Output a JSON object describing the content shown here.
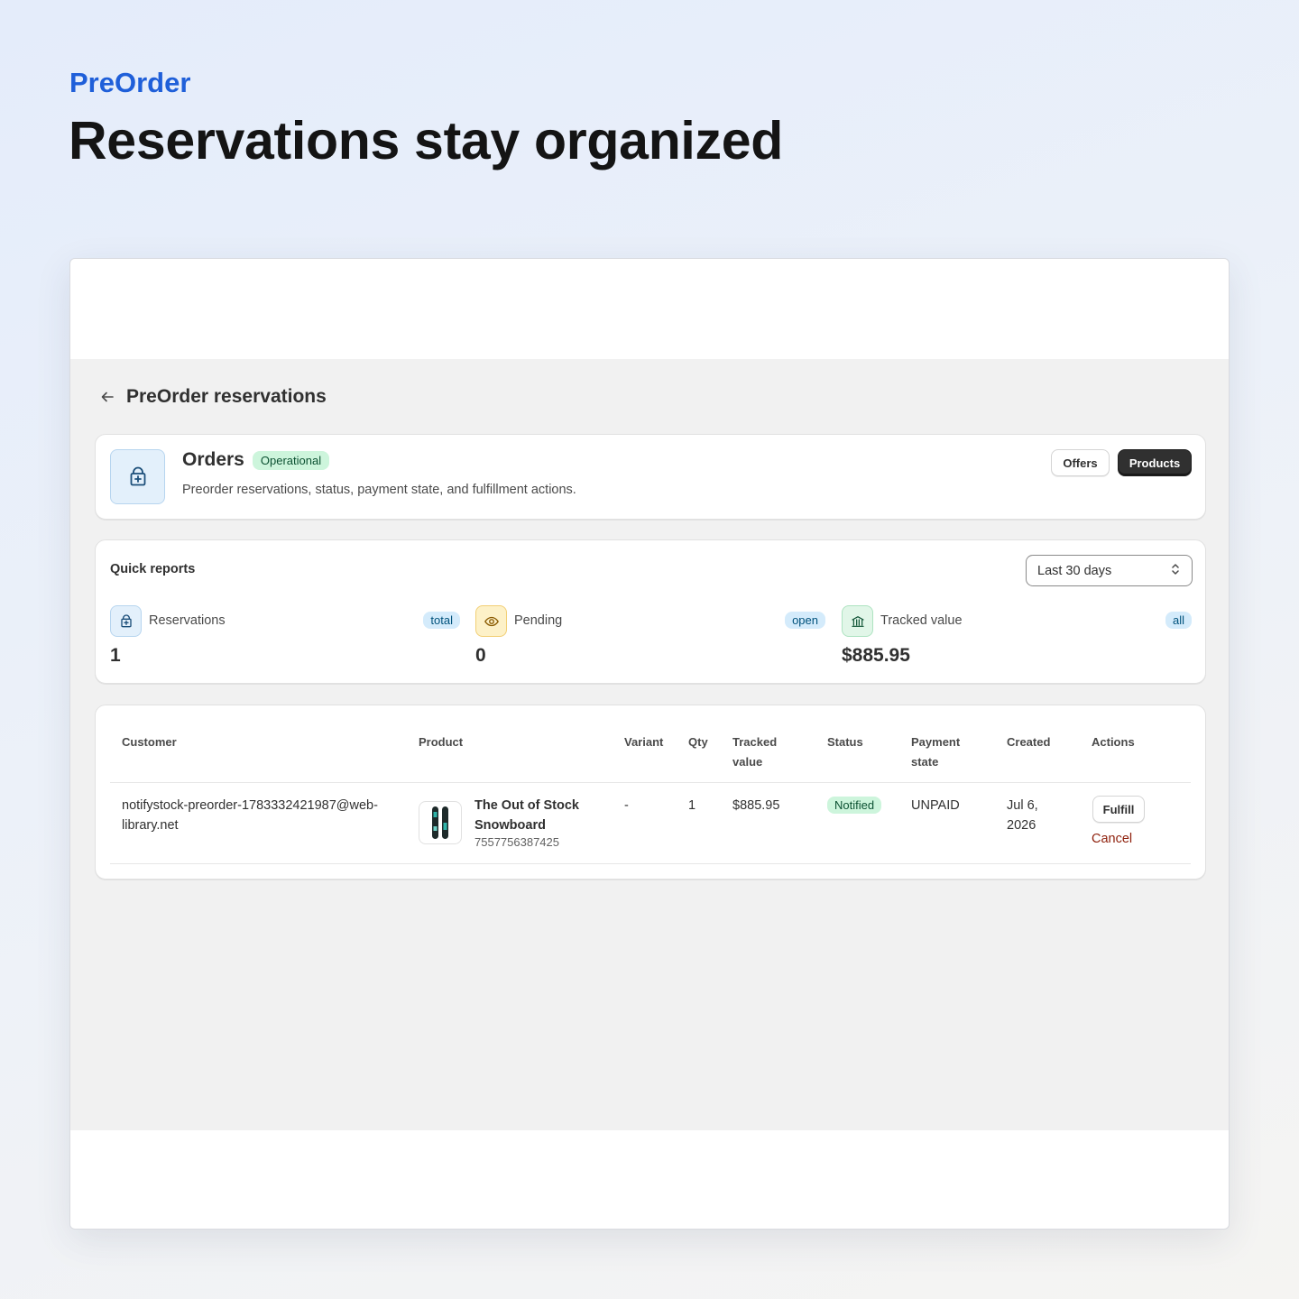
{
  "hero": {
    "kicker": "PreOrder",
    "title": "Reservations stay organized"
  },
  "page": {
    "title": "PreOrder reservations",
    "back_icon": "arrow-left-icon"
  },
  "orders": {
    "title": "Orders",
    "status_badge": "Operational",
    "description": "Preorder reservations, status, payment state, and fulfillment actions.",
    "icon": "shopping-bag-icon",
    "offers_label": "Offers",
    "products_label": "Products"
  },
  "reports": {
    "title": "Quick reports",
    "range": "Last 30 days",
    "metrics": [
      {
        "label": "Reservations",
        "pill": "total",
        "value": "1",
        "icon": "shopping-bag-icon"
      },
      {
        "label": "Pending",
        "pill": "open",
        "value": "0",
        "icon": "eye-icon"
      },
      {
        "label": "Tracked value",
        "pill": "all",
        "value": "$885.95",
        "icon": "bank-icon"
      }
    ]
  },
  "table": {
    "headers": {
      "customer": "Customer",
      "product": "Product",
      "variant": "Variant",
      "qty": "Qty",
      "tracked_line1": "Tracked",
      "tracked_line2": "value",
      "status": "Status",
      "payment_line1": "Payment",
      "payment_line2": "state",
      "created": "Created",
      "actions": "Actions"
    },
    "rows": [
      {
        "customer_line1": "notifystock-preorder-1783332421987@web-",
        "customer_line2": "library.net",
        "product_name_line1": "The Out of Stock",
        "product_name_line2": "Snowboard",
        "product_id": "7557756387425",
        "variant": "-",
        "qty": "1",
        "tracked_value": "$885.95",
        "status": "Notified",
        "payment_state": "UNPAID",
        "created_line1": "Jul 6,",
        "created_line2": "2026",
        "fulfill_label": "Fulfill",
        "cancel_label": "Cancel"
      }
    ]
  },
  "colors": {
    "brand_blue": "#1f5fd9",
    "success_bg": "#cdf5dc",
    "critical_text": "#8e1f0b",
    "primary_button": "#303030"
  }
}
